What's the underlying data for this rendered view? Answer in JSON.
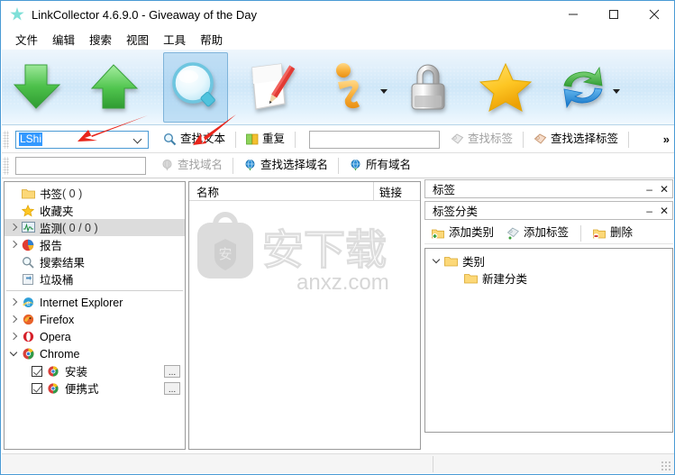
{
  "window": {
    "title": "LinkCollector 4.6.9.0 - Giveaway of the Day",
    "app_icon": "star-icon",
    "minimize_label": "–",
    "maximize_label": "□",
    "close_label": "✕",
    "accent_color": "#4a9ad4"
  },
  "menubar": {
    "items": [
      {
        "label": "文件"
      },
      {
        "label": "编辑"
      },
      {
        "label": "搜索"
      },
      {
        "label": "视图"
      },
      {
        "label": "工具"
      },
      {
        "label": "帮助"
      }
    ]
  },
  "toolbar": {
    "items": [
      {
        "icon": "green-down-arrow-icon",
        "selected": false,
        "has_dropdown": false
      },
      {
        "icon": "green-up-arrow-icon",
        "selected": false,
        "has_dropdown": false
      },
      {
        "icon": "magnifier-icon",
        "selected": true,
        "has_dropdown": false
      },
      {
        "icon": "document-pencil-icon",
        "selected": false,
        "has_dropdown": false
      },
      {
        "icon": "info-icon",
        "selected": false,
        "has_dropdown": true
      },
      {
        "icon": "lock-icon",
        "selected": false,
        "has_dropdown": false
      },
      {
        "icon": "yellow-star-icon",
        "selected": false,
        "has_dropdown": false
      },
      {
        "icon": "refresh-sync-icon",
        "selected": false,
        "has_dropdown": true
      }
    ]
  },
  "search_row1": {
    "combo_value": "LShi",
    "find_text_label": "查找文本",
    "find_text_icon": "magnifier-icon",
    "duplicate_label": "重复",
    "duplicate_icon": "duplicate-icon",
    "tag_input_value": "",
    "find_tag_label": "查找标签",
    "find_tag_icon": "tag-icon",
    "find_tag_disabled": true,
    "find_selected_tag_label": "查找选择标签",
    "find_selected_tag_icon": "tag-icon",
    "overflow_label": "»"
  },
  "search_row2": {
    "domain_input_value": "",
    "find_domain_label": "查找域名",
    "find_domain_icon": "globe-icon",
    "find_domain_disabled": true,
    "find_selected_domain_label": "查找选择域名",
    "find_selected_domain_icon": "globe-icon",
    "all_domains_label": "所有域名",
    "all_domains_icon": "globe-icon"
  },
  "sidebar": {
    "items": [
      {
        "label": "书签",
        "count": " ( 0 )",
        "icon": "folder-icon",
        "expandable": false,
        "selected": false,
        "indent": 0
      },
      {
        "label": "收藏夹",
        "count": "",
        "icon": "yellow-star-icon",
        "expandable": false,
        "selected": false,
        "indent": 0
      },
      {
        "label": "监测",
        "count": " ( 0 / 0 )",
        "icon": "monitor-icon",
        "expandable": true,
        "selected": true,
        "indent": 0
      },
      {
        "label": "报告",
        "count": "",
        "icon": "piechart-icon",
        "expandable": true,
        "selected": false,
        "indent": 0
      },
      {
        "label": "搜索结果",
        "count": "",
        "icon": "magnifier-icon",
        "expandable": false,
        "selected": false,
        "indent": 0
      },
      {
        "label": "垃圾桶",
        "count": "",
        "icon": "recycle-bin-icon",
        "expandable": false,
        "selected": false,
        "indent": 0
      }
    ],
    "browsers": [
      {
        "label": "Internet Explorer",
        "icon": "ie-icon",
        "expandable": true,
        "expanded": false
      },
      {
        "label": "Firefox",
        "icon": "firefox-icon",
        "expandable": true,
        "expanded": false
      },
      {
        "label": "Opera",
        "icon": "opera-icon",
        "expandable": true,
        "expanded": false
      },
      {
        "label": "Chrome",
        "icon": "chrome-icon",
        "expandable": true,
        "expanded": true
      }
    ],
    "chrome_children": [
      {
        "label": "安装",
        "icon": "chrome-icon",
        "checked": true,
        "more_label": "..."
      },
      {
        "label": "便携式",
        "icon": "chrome-icon",
        "checked": true,
        "more_label": "..."
      }
    ]
  },
  "list_panel": {
    "columns": [
      {
        "label": "名称"
      },
      {
        "label": "链接"
      }
    ],
    "rows": [],
    "watermark_text": "anxz.com",
    "watermark_badge": "安"
  },
  "tags_panel": {
    "header_label": "标签",
    "minimize_label": "–",
    "close_label": "✕"
  },
  "tag_category_panel": {
    "header_label": "标签分类",
    "minimize_label": "–",
    "close_label": "✕",
    "toolbar": [
      {
        "label": "添加类别",
        "icon": "add-folder-icon"
      },
      {
        "label": "添加标签",
        "icon": "add-tag-icon"
      },
      {
        "label": "删除",
        "icon": "delete-folder-icon"
      }
    ],
    "tree": [
      {
        "label": "类别",
        "icon": "folder-icon",
        "expandable": true,
        "expanded": true,
        "indent": 0
      },
      {
        "label": "新建分类",
        "icon": "folder-icon",
        "expandable": false,
        "expanded": false,
        "indent": 1
      }
    ]
  },
  "annotations": {
    "arrow_color": "#e8251b",
    "arrows": [
      {
        "target": "combo-input"
      },
      {
        "target": "find-text-button"
      }
    ]
  }
}
